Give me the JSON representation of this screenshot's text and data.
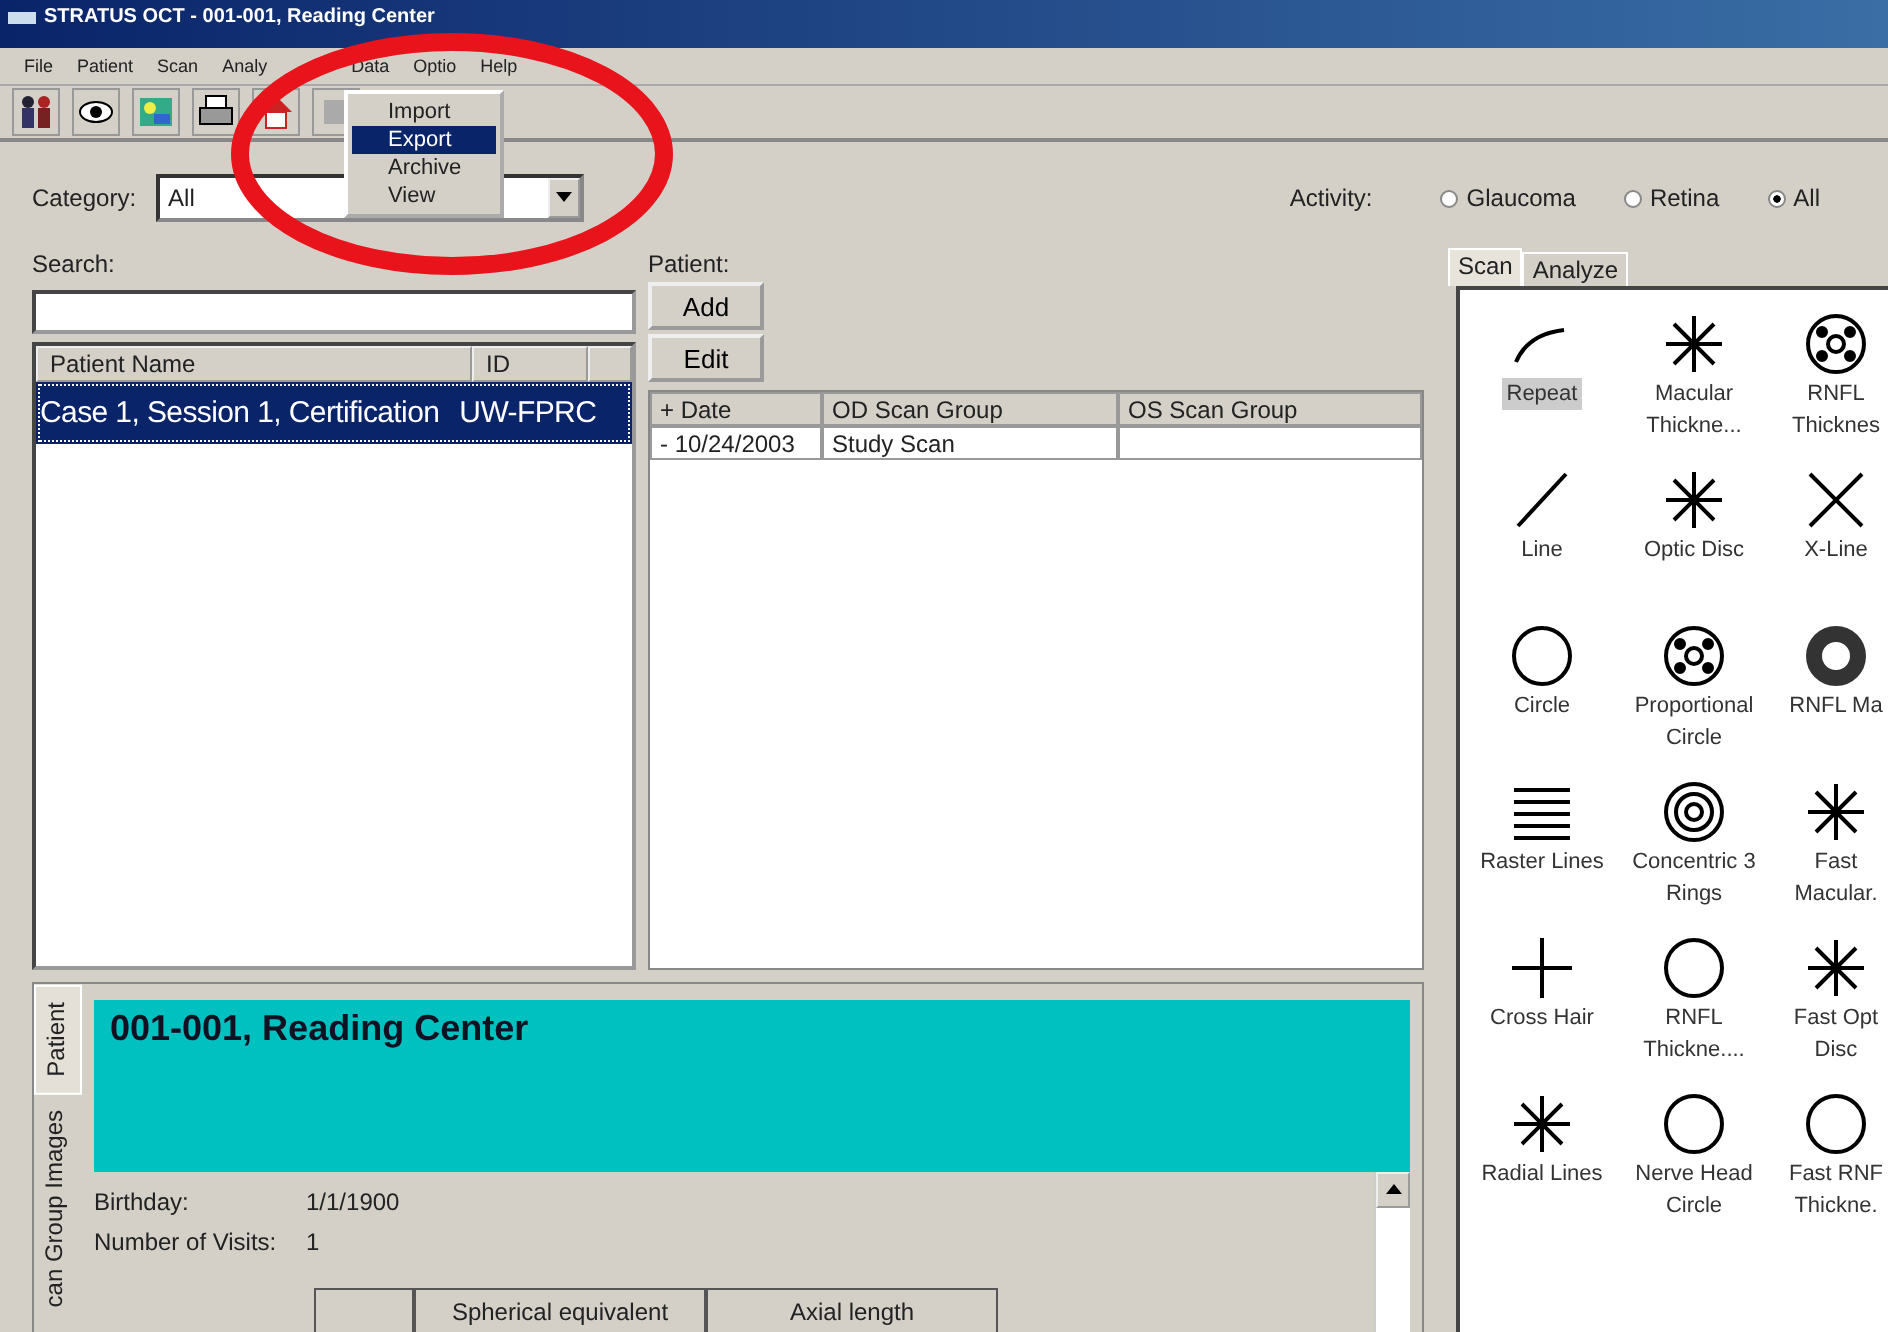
{
  "window": {
    "title": "STRATUS OCT - 001-001, Reading Center"
  },
  "menu": [
    {
      "label": "File"
    },
    {
      "label": "Patient"
    },
    {
      "label": "Scan"
    },
    {
      "label": "Analy"
    },
    {
      "label": "Data"
    },
    {
      "label": "Optio"
    },
    {
      "label": "Help"
    }
  ],
  "data_menu": {
    "items": [
      {
        "label": "Import",
        "selected": false
      },
      {
        "label": "Export",
        "selected": true
      },
      {
        "label": "Archive",
        "selected": false
      },
      {
        "label": "View",
        "selected": false
      }
    ]
  },
  "toolbar": [
    {
      "kind": "people"
    },
    {
      "kind": "eye"
    },
    {
      "kind": "image"
    },
    {
      "kind": "printer"
    },
    {
      "kind": "home"
    },
    {
      "kind": "blank"
    }
  ],
  "category": {
    "label": "Category:",
    "value": "All"
  },
  "activity": {
    "label": "Activity:",
    "options": [
      {
        "label": "Glaucoma",
        "selected": false
      },
      {
        "label": "Retina",
        "selected": false
      },
      {
        "label": "All",
        "selected": true
      }
    ]
  },
  "search": {
    "label": "Search:"
  },
  "patient_list": {
    "columns": [
      "Patient Name",
      "ID"
    ],
    "rows": [
      {
        "name": "Case 1, Session 1, Certification",
        "id": "UW-FPRC",
        "selected": true
      }
    ]
  },
  "patient": {
    "label": "Patient:",
    "buttons": [
      "Add",
      "Edit"
    ]
  },
  "scan_table": {
    "columns": [
      "+ Date",
      "OD Scan Group",
      "OS Scan Group"
    ],
    "rows": [
      [
        "- 10/24/2003",
        "Study Scan",
        ""
      ]
    ]
  },
  "side_tabs": [
    {
      "label": "Scan",
      "selected": true
    },
    {
      "label": "Analyze",
      "selected": false
    }
  ],
  "scans": [
    {
      "kind": "arc",
      "label": "Repeat",
      "selected": true
    },
    {
      "kind": "asterisk",
      "label": "Macular Thickne...",
      "selected": false
    },
    {
      "kind": "dots",
      "label": "RNFL Thicknes",
      "selected": false
    },
    {
      "kind": "line",
      "label": "Line",
      "selected": false
    },
    {
      "kind": "asterisk",
      "label": "Optic Disc",
      "selected": false
    },
    {
      "kind": "cross",
      "label": "X-Line",
      "selected": false
    },
    {
      "kind": "circle",
      "label": "Circle",
      "selected": false
    },
    {
      "kind": "dots",
      "label": "Proportional Circle",
      "selected": false
    },
    {
      "kind": "filled",
      "label": "RNFL Ma",
      "selected": false
    },
    {
      "kind": "raster",
      "label": "Raster Lines",
      "selected": false
    },
    {
      "kind": "rings",
      "label": "Concentric 3 Rings",
      "selected": false
    },
    {
      "kind": "asterisk",
      "label": "Fast Macular.",
      "selected": false
    },
    {
      "kind": "crosshair",
      "label": "Cross Hair",
      "selected": false
    },
    {
      "kind": "circle",
      "label": "RNFL Thickne....",
      "selected": false
    },
    {
      "kind": "asterisk",
      "label": "Fast Opt Disc",
      "selected": false
    },
    {
      "kind": "asterisk",
      "label": "Radial Lines",
      "selected": false
    },
    {
      "kind": "circle",
      "label": "Nerve Head Circle",
      "selected": false
    },
    {
      "kind": "circle",
      "label": "Fast RNF Thickne.",
      "selected": false
    }
  ],
  "detail_tabs": [
    {
      "label": "Patient",
      "selected": true
    },
    {
      "label": "can Group Images",
      "selected": false
    }
  ],
  "detail": {
    "heading": "001-001, Reading Center",
    "fields": [
      {
        "label": "Birthday:",
        "value": "1/1/1900"
      },
      {
        "label": "Number of Visits:",
        "value": "1"
      }
    ],
    "table_columns": [
      "",
      "Spherical equivalent",
      "Axial length"
    ]
  }
}
